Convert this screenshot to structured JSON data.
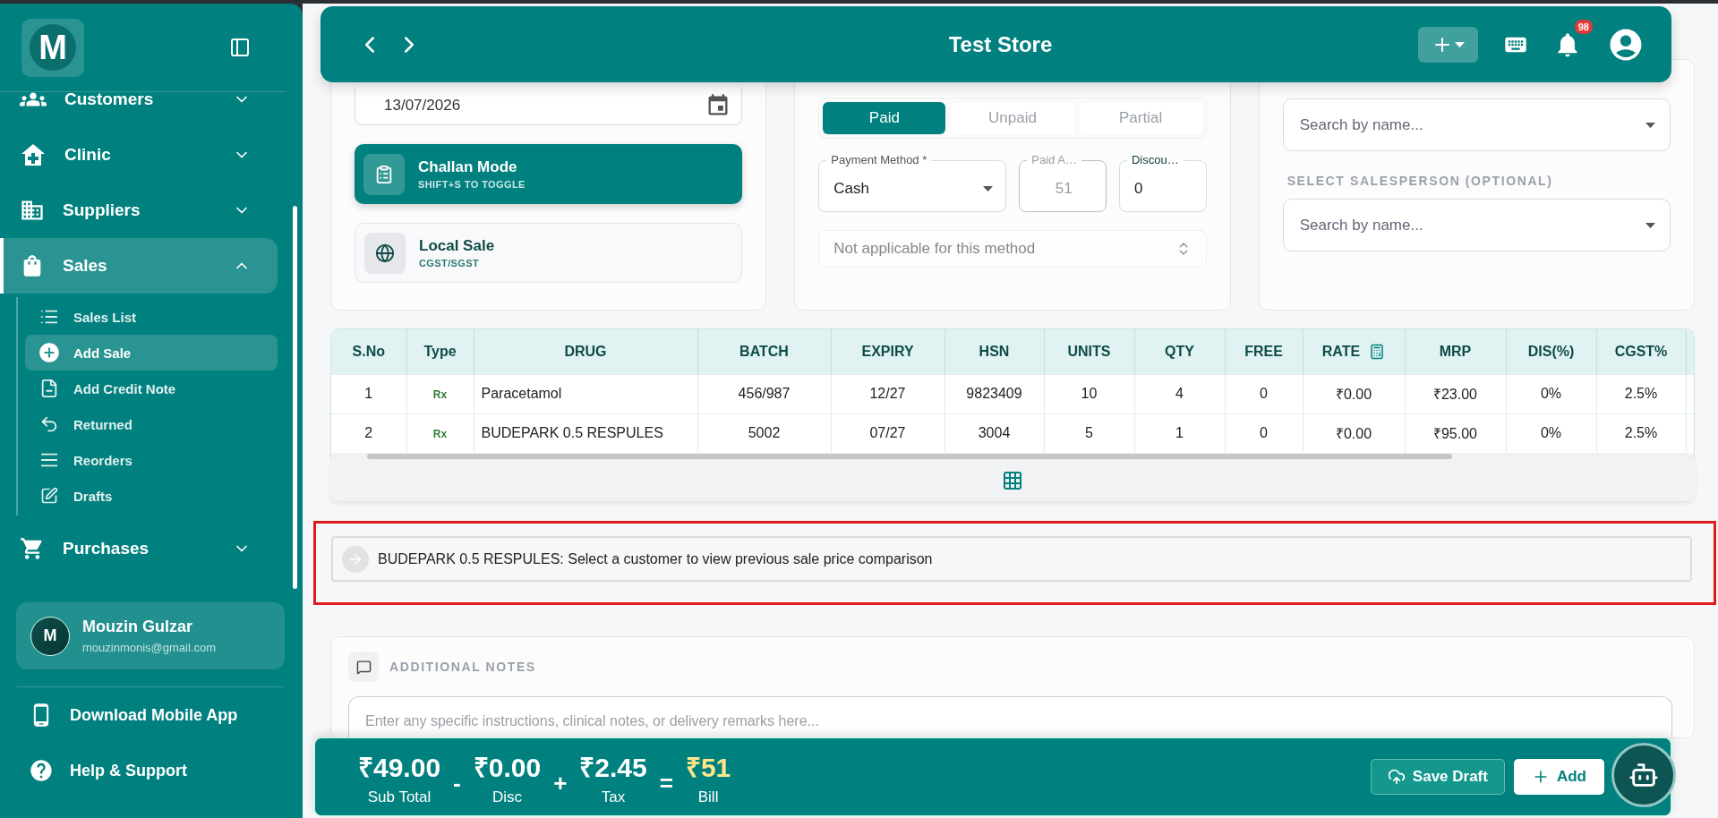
{
  "sidebar": {
    "logo": "M",
    "nav": [
      {
        "label": "Customers",
        "selected": false,
        "expanded": false
      },
      {
        "label": "Clinic",
        "selected": false,
        "expanded": false
      },
      {
        "label": "Suppliers",
        "selected": false,
        "expanded": false
      },
      {
        "label": "Sales",
        "selected": true,
        "expanded": true,
        "children": [
          {
            "label": "Sales List",
            "selected": false
          },
          {
            "label": "Add Sale",
            "selected": true
          },
          {
            "label": "Add Credit Note",
            "selected": false
          },
          {
            "label": "Returned",
            "selected": false
          },
          {
            "label": "Reorders",
            "selected": false
          },
          {
            "label": "Drafts",
            "selected": false
          }
        ]
      },
      {
        "label": "Purchases",
        "selected": false,
        "expanded": false
      }
    ],
    "user": {
      "initial": "M",
      "name": "Mouzin Gulzar",
      "email": "mouzinmonis@gmail.com"
    },
    "footer_links": [
      {
        "label": "Download Mobile App"
      },
      {
        "label": "Help & Support"
      }
    ]
  },
  "header": {
    "title": "Test Store",
    "notification_count": "98"
  },
  "sale_details": {
    "date": "13/07/2026",
    "modes": [
      {
        "title": "Challan Mode",
        "subtitle": "SHIFT+S TO TOGGLE",
        "selected": true
      },
      {
        "title": "Local Sale",
        "subtitle": "CGST/SGST",
        "selected": false
      }
    ]
  },
  "payment": {
    "status_tabs": [
      {
        "label": "Paid",
        "selected": true
      },
      {
        "label": "Unpaid",
        "selected": false
      },
      {
        "label": "Partial",
        "selected": false
      }
    ],
    "fields": [
      {
        "kind": "select",
        "label": "Payment Method *",
        "value": "Cash",
        "disabled": false
      },
      {
        "kind": "input",
        "label": "Paid A…",
        "value": "51",
        "disabled": true
      },
      {
        "kind": "input",
        "label": "Discou…",
        "value": "0",
        "disabled": false
      }
    ],
    "reference": {
      "placeholder": "Not applicable for this method"
    }
  },
  "parties": {
    "customer": {
      "placeholder": "Search by name..."
    },
    "salesperson": {
      "label": "SELECT SALESPERSON (OPTIONAL)",
      "placeholder": "Search by name..."
    }
  },
  "table": {
    "columns": [
      {
        "label": "S.No",
        "kind": "plain"
      },
      {
        "label": "Type",
        "kind": "plain"
      },
      {
        "label": "DRUG",
        "kind": "plain"
      },
      {
        "label": "BATCH",
        "kind": "plain"
      },
      {
        "label": "EXPIRY",
        "kind": "plain"
      },
      {
        "label": "HSN",
        "kind": "plain"
      },
      {
        "label": "UNITS",
        "kind": "plain"
      },
      {
        "label": "QTY",
        "kind": "plain"
      },
      {
        "label": "FREE",
        "kind": "plain"
      },
      {
        "label": "RATE",
        "kind": "calculator"
      },
      {
        "label": "MRP",
        "kind": "plain"
      },
      {
        "label": "DIS(%)",
        "kind": "plain"
      },
      {
        "label": "CGST%",
        "kind": "plain"
      }
    ],
    "rows": [
      [
        "1",
        "Rx",
        "Paracetamol",
        "456/987",
        "12/27",
        "9823409",
        "10",
        "4",
        "0",
        "₹0.00",
        "₹23.00",
        "0%",
        "2.5%"
      ],
      [
        "2",
        "Rx",
        "BUDEPARK 0.5 RESPULES",
        "5002",
        "07/27",
        "3004",
        "5",
        "1",
        "0",
        "₹0.00",
        "₹95.00",
        "0%",
        "2.5%"
      ]
    ]
  },
  "price_comparison": {
    "message": "BUDEPARK 0.5 RESPULES: Select a customer to view previous sale price comparison"
  },
  "notes": {
    "title": "ADDITIONAL NOTES",
    "placeholder": "Enter any specific instructions, clinical notes, or delivery remarks here..."
  },
  "totals": [
    {
      "kind": "term",
      "amount": "₹49.00",
      "label": "Sub Total"
    },
    {
      "kind": "operator",
      "symbol": "-"
    },
    {
      "kind": "term",
      "amount": "₹0.00",
      "label": "Disc"
    },
    {
      "kind": "operator",
      "symbol": "+"
    },
    {
      "kind": "term",
      "amount": "₹2.45",
      "label": "Tax"
    },
    {
      "kind": "operator",
      "symbol": "="
    },
    {
      "kind": "grand",
      "amount": "₹51",
      "label": "Bill"
    }
  ],
  "actions": [
    {
      "kind": "secondary",
      "label": "Save Draft"
    },
    {
      "kind": "primary",
      "label": "Add"
    }
  ]
}
